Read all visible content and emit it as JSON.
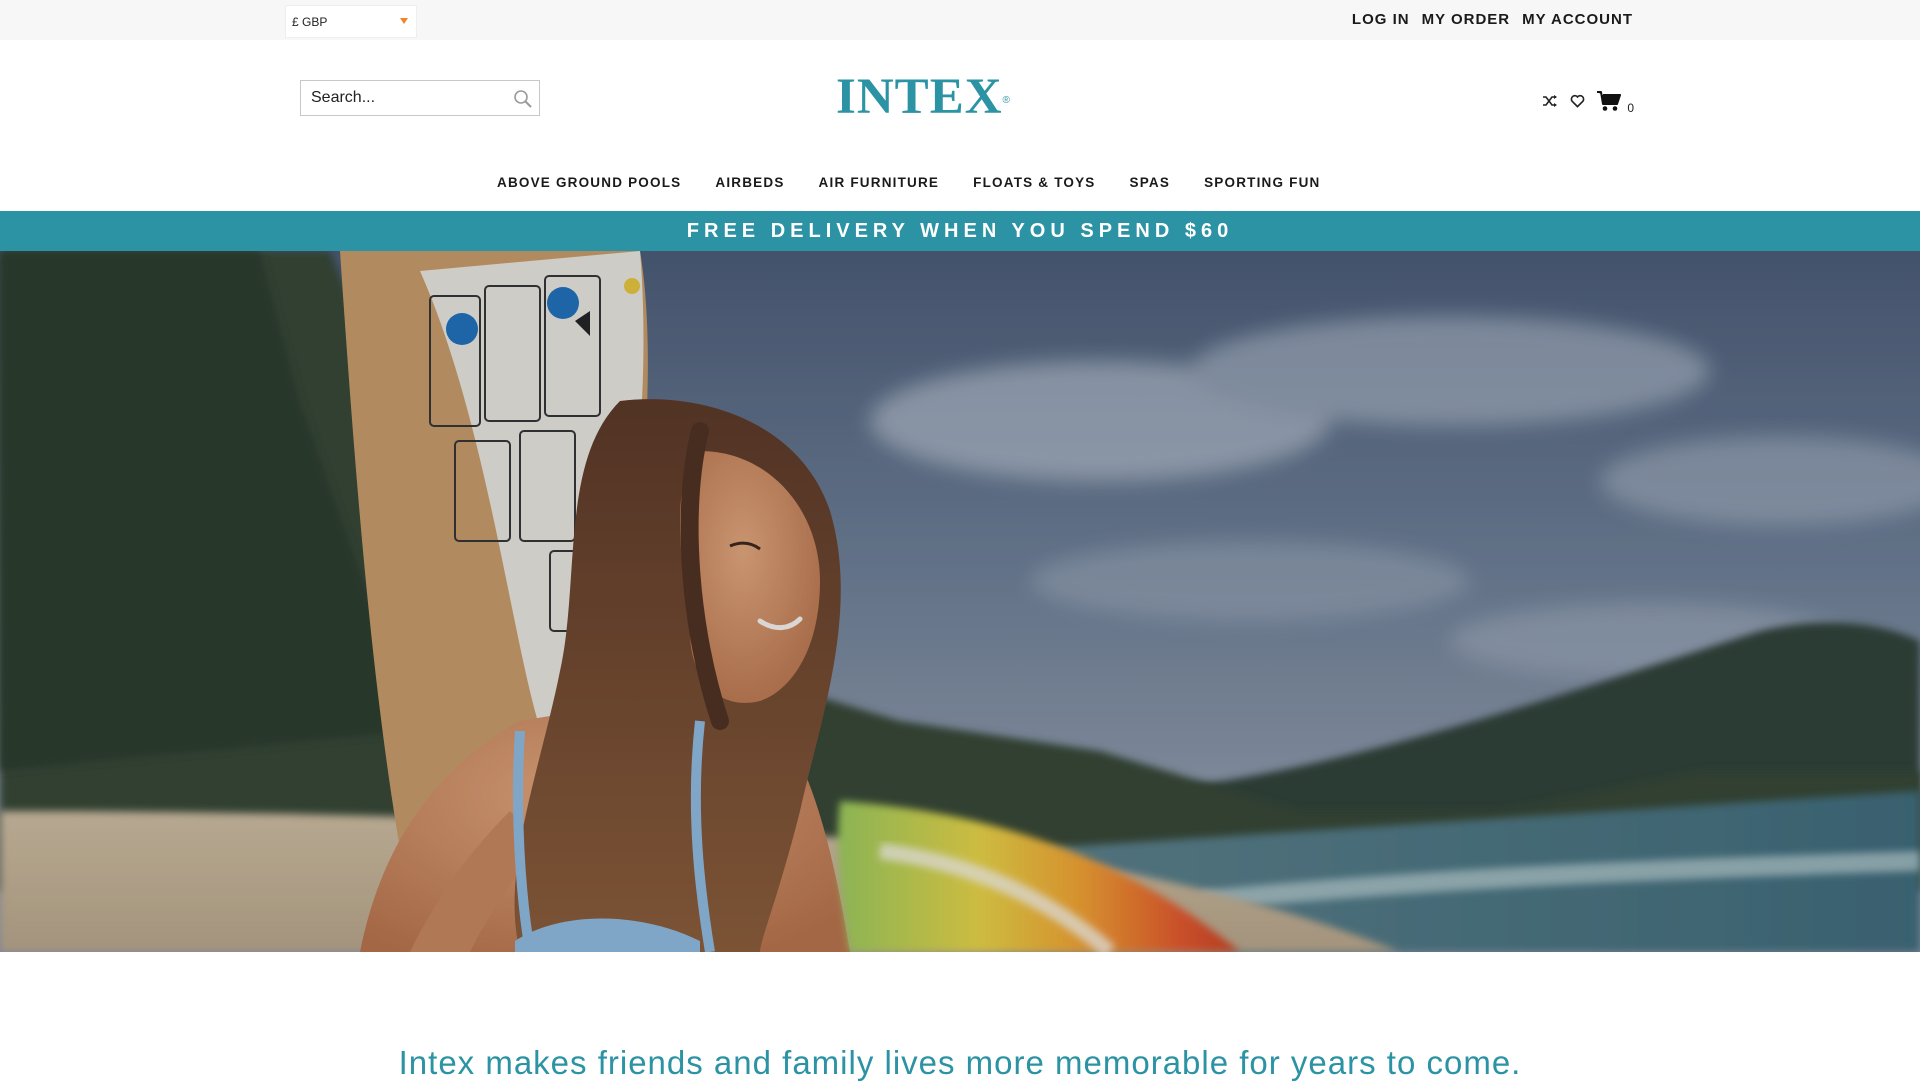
{
  "topbar": {
    "currency": "£ GBP",
    "links": [
      "LOG IN",
      "MY ORDER",
      "MY ACCOUNT"
    ]
  },
  "header": {
    "search_placeholder": "Search...",
    "logo": "INTEX",
    "logo_mark": "®",
    "cart_count": "0",
    "icons": [
      "shuffle-icon",
      "heart-icon",
      "cart-icon"
    ]
  },
  "nav": {
    "items": [
      "ABOVE GROUND POOLS",
      "AIRBEDS",
      "AIR FURNITURE",
      "FLOATS & TOYS",
      "SPAS",
      "SPORTING FUN"
    ]
  },
  "promo": {
    "text": "FREE DELIVERY WHEN YOU SPEND $60"
  },
  "tagline": {
    "text": "Intex makes friends and family lives more memorable for years to come."
  },
  "colors": {
    "brand": "#2b93a4",
    "topbar_bg": "#f7f7f7",
    "currency_caret": "#f0862a"
  }
}
